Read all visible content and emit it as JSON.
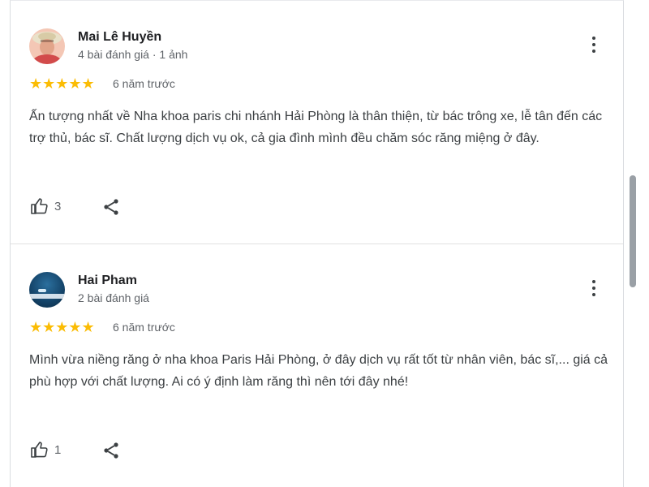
{
  "reviews": [
    {
      "author": "Mai Lê Huyền",
      "meta": "4 bài đánh giá · 1 ảnh",
      "stars": "★★★★★",
      "rating": 5,
      "time": "6 năm trước",
      "text": "Ấn tượng nhất về Nha khoa paris chi nhánh Hải Phòng là thân thiện, từ bác trông xe, lễ tân đến các trợ thủ, bác sĩ. Chất lượng dịch vụ ok, cả gia đình mình đều chăm sóc răng miệng ở đây.",
      "likes": "3"
    },
    {
      "author": "Hai Pham",
      "meta": "2 bài đánh giá",
      "stars": "★★★★★",
      "rating": 5,
      "time": "6 năm trước",
      "text": "Mình vừa niềng răng ở nha khoa Paris Hải Phòng, ở đây dịch vụ rất tốt từ nhân viên, bác sĩ,... giá cả phù hợp với chất lượng. Ai có ý định làm răng thì nên tới đây nhé!",
      "likes": "1"
    }
  ],
  "colors": {
    "star": "#fbbc04",
    "text": "#3c4043",
    "meta": "#5f6368"
  },
  "icons": {
    "more": "more-vert-icon",
    "like": "thumb-up-icon",
    "share": "share-icon"
  }
}
